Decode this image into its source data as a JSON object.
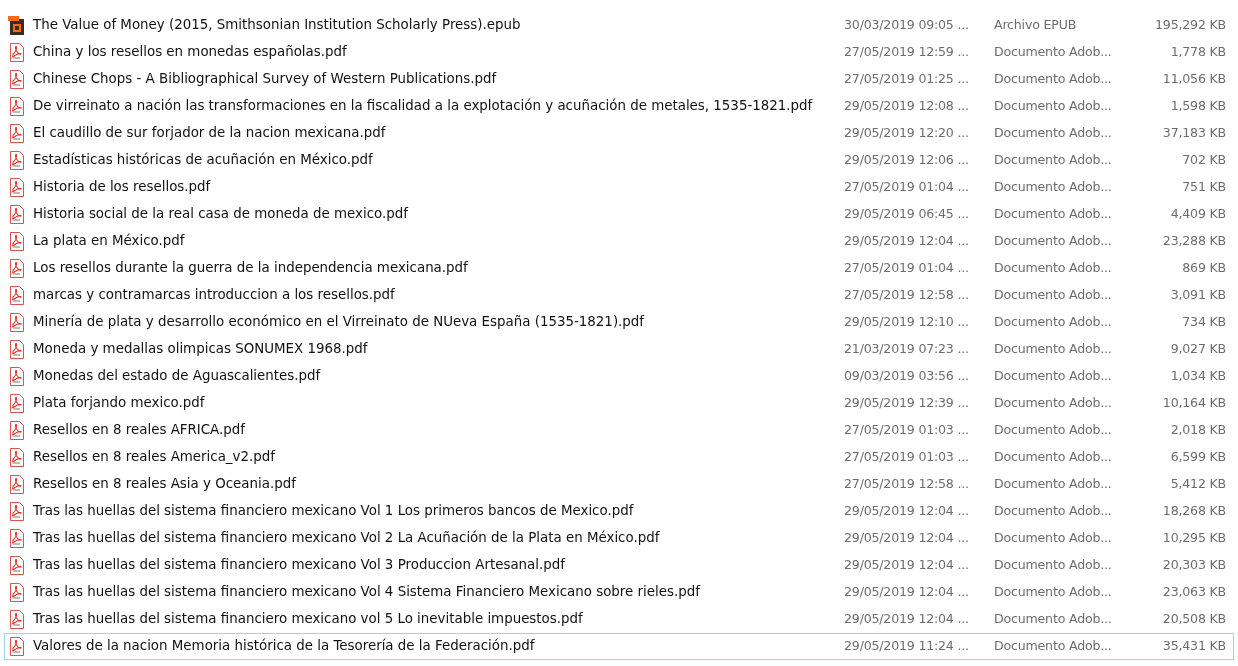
{
  "files": [
    {
      "kind": "epub",
      "name": "The Value of Money (2015, Smithsonian Institution Scholarly Press).epub",
      "modified": "30/03/2019 09:05 ...",
      "type": "Archivo EPUB",
      "size": "195,292 KB",
      "focused": false
    },
    {
      "kind": "pdf",
      "name": "China y los resellos en monedas españolas.pdf",
      "modified": "27/05/2019 12:59 ...",
      "type": "Documento Adob...",
      "size": "1,778 KB",
      "focused": false
    },
    {
      "kind": "pdf",
      "name": "Chinese Chops - A Bibliographical Survey of Western Publications.pdf",
      "modified": "27/05/2019 01:25 ...",
      "type": "Documento Adob...",
      "size": "11,056 KB",
      "focused": false
    },
    {
      "kind": "pdf",
      "name": "De virreinato a nación las transformaciones en la fiscalidad a la explotación y acuñación de metales, 1535-1821.pdf",
      "modified": "29/05/2019 12:08 ...",
      "type": "Documento Adob...",
      "size": "1,598 KB",
      "focused": false
    },
    {
      "kind": "pdf",
      "name": "El caudillo de sur forjador de la nacion mexicana.pdf",
      "modified": "29/05/2019 12:20 ...",
      "type": "Documento Adob...",
      "size": "37,183 KB",
      "focused": false
    },
    {
      "kind": "pdf",
      "name": "Estadísticas históricas de acuñación en México.pdf",
      "modified": "29/05/2019 12:06 ...",
      "type": "Documento Adob...",
      "size": "702 KB",
      "focused": false
    },
    {
      "kind": "pdf",
      "name": "Historia de los resellos.pdf",
      "modified": "27/05/2019 01:04 ...",
      "type": "Documento Adob...",
      "size": "751 KB",
      "focused": false
    },
    {
      "kind": "pdf",
      "name": "Historia social de la real casa de moneda de mexico.pdf",
      "modified": "29/05/2019 06:45 ...",
      "type": "Documento Adob...",
      "size": "4,409 KB",
      "focused": false
    },
    {
      "kind": "pdf",
      "name": "La plata en México.pdf",
      "modified": "29/05/2019 12:04 ...",
      "type": "Documento Adob...",
      "size": "23,288 KB",
      "focused": false
    },
    {
      "kind": "pdf",
      "name": "Los resellos durante la guerra de la independencia mexicana.pdf",
      "modified": "27/05/2019 01:04 ...",
      "type": "Documento Adob...",
      "size": "869 KB",
      "focused": false
    },
    {
      "kind": "pdf",
      "name": "marcas y contramarcas introduccion a los resellos.pdf",
      "modified": "27/05/2019 12:58 ...",
      "type": "Documento Adob...",
      "size": "3,091 KB",
      "focused": false
    },
    {
      "kind": "pdf",
      "name": "Minería de plata y desarrollo económico en el Virreinato de NUeva España (1535-1821).pdf",
      "modified": "29/05/2019 12:10 ...",
      "type": "Documento Adob...",
      "size": "734 KB",
      "focused": false
    },
    {
      "kind": "pdf",
      "name": "Moneda y medallas olimpicas SONUMEX 1968.pdf",
      "modified": "21/03/2019 07:23 ...",
      "type": "Documento Adob...",
      "size": "9,027 KB",
      "focused": false
    },
    {
      "kind": "pdf",
      "name": "Monedas del estado de Aguascalientes.pdf",
      "modified": "09/03/2019 03:56 ...",
      "type": "Documento Adob...",
      "size": "1,034 KB",
      "focused": false
    },
    {
      "kind": "pdf",
      "name": "Plata forjando mexico.pdf",
      "modified": "29/05/2019 12:39 ...",
      "type": "Documento Adob...",
      "size": "10,164 KB",
      "focused": false
    },
    {
      "kind": "pdf",
      "name": "Resellos en 8 reales AFRICA.pdf",
      "modified": "27/05/2019 01:03 ...",
      "type": "Documento Adob...",
      "size": "2,018 KB",
      "focused": false
    },
    {
      "kind": "pdf",
      "name": "Resellos en 8 reales America_v2.pdf",
      "modified": "27/05/2019 01:03 ...",
      "type": "Documento Adob...",
      "size": "6,599 KB",
      "focused": false
    },
    {
      "kind": "pdf",
      "name": "Resellos en 8 reales Asia y Oceania.pdf",
      "modified": "27/05/2019 12:58 ...",
      "type": "Documento Adob...",
      "size": "5,412 KB",
      "focused": false
    },
    {
      "kind": "pdf",
      "name": "Tras las huellas del sistema financiero mexicano Vol 1 Los primeros bancos de Mexico.pdf",
      "modified": "29/05/2019 12:04 ...",
      "type": "Documento Adob...",
      "size": "18,268 KB",
      "focused": false
    },
    {
      "kind": "pdf",
      "name": "Tras las huellas del sistema financiero mexicano Vol 2 La Acuñación de la Plata en México.pdf",
      "modified": "29/05/2019 12:04 ...",
      "type": "Documento Adob...",
      "size": "10,295 KB",
      "focused": false
    },
    {
      "kind": "pdf",
      "name": "Tras las huellas del sistema financiero mexicano Vol 3 Produccion Artesanal.pdf",
      "modified": "29/05/2019 12:04 ...",
      "type": "Documento Adob...",
      "size": "20,303 KB",
      "focused": false
    },
    {
      "kind": "pdf",
      "name": "Tras las huellas del sistema financiero mexicano Vol 4 Sistema Financiero Mexicano sobre rieles.pdf",
      "modified": "29/05/2019 12:04 ...",
      "type": "Documento Adob...",
      "size": "23,063 KB",
      "focused": false
    },
    {
      "kind": "pdf",
      "name": "Tras las huellas del sistema financiero mexicano vol 5 Lo inevitable impuestos.pdf",
      "modified": "29/05/2019 12:04 ...",
      "type": "Documento Adob...",
      "size": "20,508 KB",
      "focused": false
    },
    {
      "kind": "pdf",
      "name": "Valores de la nacion Memoria histórica de la Tesorería de la Federación.pdf",
      "modified": "29/05/2019 11:24 ...",
      "type": "Documento Adob...",
      "size": "35,431 KB",
      "focused": true
    }
  ]
}
